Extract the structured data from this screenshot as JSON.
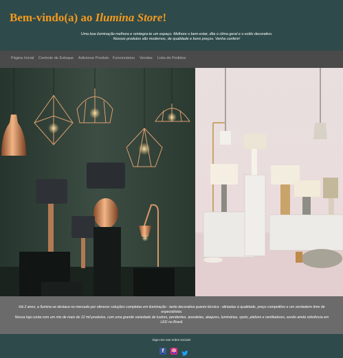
{
  "header": {
    "title_prefix": "Bem-vindo(a) ao ",
    "brand": "Ilumina Store",
    "title_suffix": "!",
    "tagline_1": "Uma boa iluminação melhora e reintegra-te um espaço. Melhore o bem-estar, dita o clima geral e o estilo decorativo.",
    "tagline_2": "Nossos produtos são modernos, de qualidade e bons preços. Venha conferir!"
  },
  "nav": {
    "items": [
      {
        "label": "Página Inicial"
      },
      {
        "label": "Controle de Estoque"
      },
      {
        "label": "Adicionar Produto"
      },
      {
        "label": "Funcionários"
      },
      {
        "label": "Vendas"
      },
      {
        "label": "Lista de Pedidos"
      }
    ]
  },
  "about": {
    "line_1": "Há 2 anos, a Ilumina se destaca no mercado por oferecer soluções completas em iluminação - tanto decorativa quanto técnica - aliniadas à qualidade, preço competitivo e um verdadeiro time de especialistas.",
    "line_2": "Nossa loja conta com um mix de mais de 12 mil produtos, com uma grande variedade de lustres, pendentes, arandelas, abajures, luminárias, spots, plafons e ventiladores, sendo ainda referência em LED no Brasil."
  },
  "footer": {
    "follow_text": "Siga-nos nas redes sociais!",
    "social": [
      {
        "icon": "facebook-icon",
        "glyph": "f",
        "color": "#3b5998"
      },
      {
        "icon": "instagram-icon",
        "glyph": "◎",
        "color": "#d6307a"
      },
      {
        "icon": "twitter-icon",
        "glyph": "🐦",
        "color": "#1da1f2"
      }
    ]
  },
  "colors": {
    "header_bg": "#2f4a4a",
    "title_accent": "#f39a1e",
    "nav_bg": "#4a4a4a",
    "about_bg": "#6b6b6b"
  }
}
